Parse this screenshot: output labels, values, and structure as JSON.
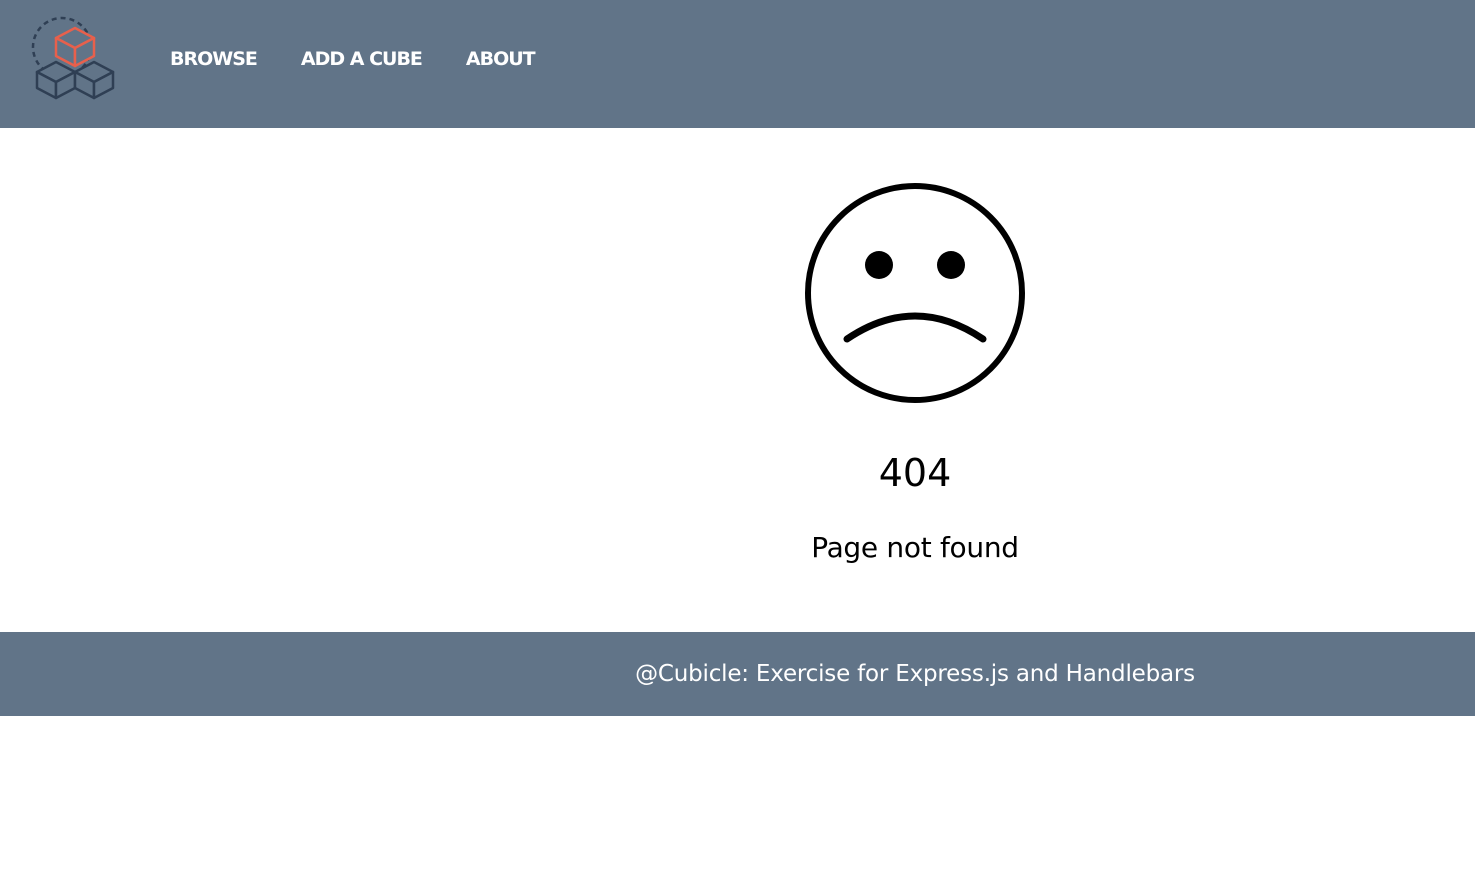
{
  "colors": {
    "header_bg": "#617488",
    "footer_bg": "#617488",
    "logo_accent": "#e8604c",
    "logo_dark": "#2f3f54",
    "text_light": "#ffffff",
    "text_dark": "#000000"
  },
  "header": {
    "logo_icon": "cubes-logo-icon",
    "nav": [
      {
        "label": "BROWSE"
      },
      {
        "label": "ADD A CUBE"
      },
      {
        "label": "ABOUT"
      }
    ]
  },
  "error": {
    "icon": "sad-face-icon",
    "code": "404",
    "message": "Page not found"
  },
  "footer": {
    "text": "@Cubicle: Exercise for Express.js and Handlebars"
  }
}
